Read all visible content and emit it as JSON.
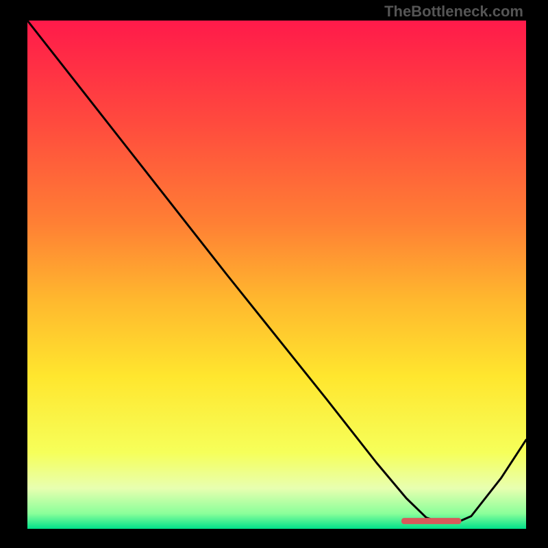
{
  "watermark": "TheBottleneck.com",
  "chart_data": {
    "type": "line",
    "x_range": [
      0,
      100
    ],
    "y_range": [
      0,
      100
    ],
    "title": "",
    "xlabel": "",
    "ylabel": "",
    "background_gradient": {
      "stops": [
        {
          "offset": 0,
          "color": "#ff1a4a"
        },
        {
          "offset": 0.2,
          "color": "#ff4a3e"
        },
        {
          "offset": 0.4,
          "color": "#ff8034"
        },
        {
          "offset": 0.55,
          "color": "#ffb82e"
        },
        {
          "offset": 0.7,
          "color": "#ffe62e"
        },
        {
          "offset": 0.85,
          "color": "#f6ff5a"
        },
        {
          "offset": 0.92,
          "color": "#e8ffb0"
        },
        {
          "offset": 0.97,
          "color": "#8aff9a"
        },
        {
          "offset": 1.0,
          "color": "#00e08a"
        }
      ]
    },
    "curve": [
      {
        "x": 0.0,
        "y": 100.0
      },
      {
        "x": 12.0,
        "y": 85.0
      },
      {
        "x": 20.0,
        "y": 75.0
      },
      {
        "x": 24.0,
        "y": 70.0
      },
      {
        "x": 40.0,
        "y": 50.0
      },
      {
        "x": 60.0,
        "y": 25.5
      },
      {
        "x": 70.0,
        "y": 13.0
      },
      {
        "x": 76.0,
        "y": 6.0
      },
      {
        "x": 80.0,
        "y": 2.2
      },
      {
        "x": 83.0,
        "y": 1.2
      },
      {
        "x": 86.0,
        "y": 1.2
      },
      {
        "x": 89.0,
        "y": 2.5
      },
      {
        "x": 95.0,
        "y": 10.0
      },
      {
        "x": 100.0,
        "y": 17.5
      }
    ],
    "marker_band": {
      "x_start": 75.0,
      "x_end": 87.0,
      "y": 1.6,
      "color": "#d85a5a"
    }
  }
}
